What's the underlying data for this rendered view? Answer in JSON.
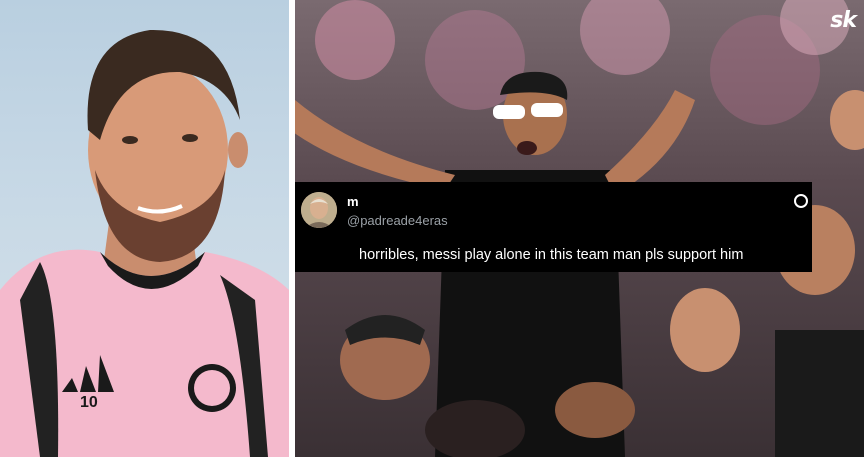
{
  "brand": {
    "logo_text": "sk"
  },
  "tweet": {
    "name": "m",
    "handle": "@padreade4eras",
    "text": "horribles, messi play alone in this team man pls support him"
  },
  "player": {
    "jersey_number": "10"
  },
  "colors": {
    "jersey_pink": "#f4b9cc",
    "tweet_bg": "#000000",
    "handle_gray": "#9aa0a6"
  },
  "icons": [
    "more-options-icon"
  ]
}
